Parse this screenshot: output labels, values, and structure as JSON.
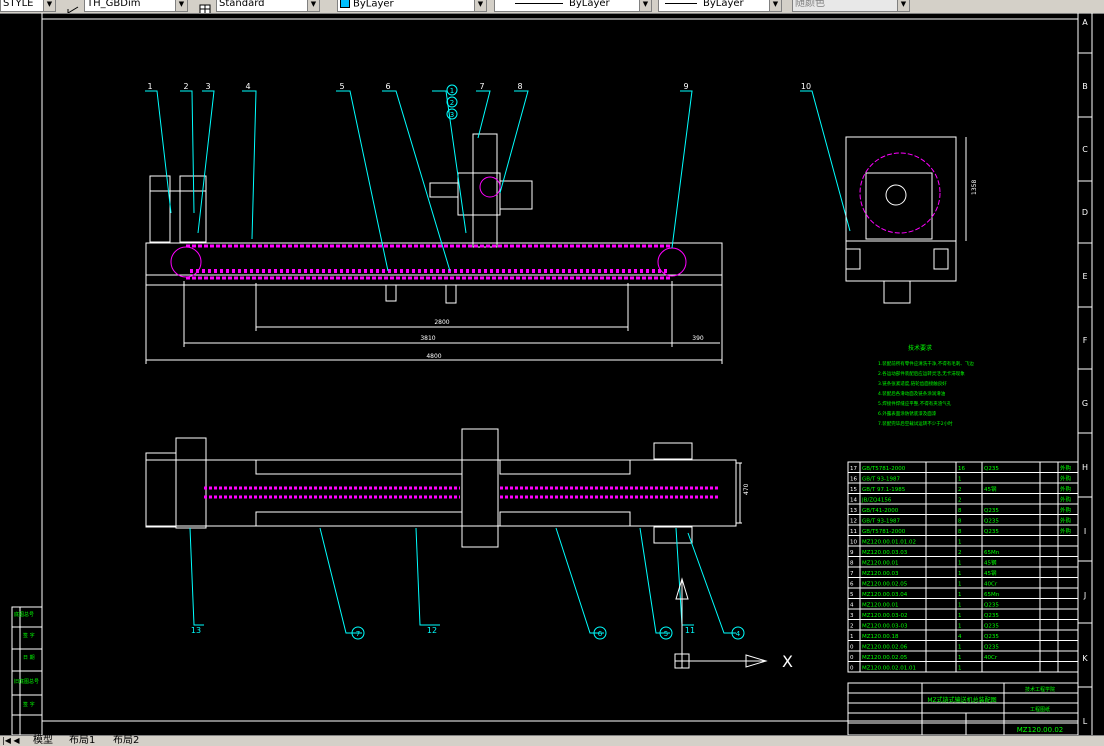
{
  "toolbar": {
    "textstyle_fragment": "STYLE",
    "dimstyle": "TH_GBDim",
    "tablestyle": "Standard",
    "layer": "ByLayer",
    "linetype": "ByLayer",
    "lineweight": "ByLayer",
    "plotcolor": "随颜色"
  },
  "tabs": {
    "model": "模型",
    "layout1": "布局1",
    "layout2": "布局2"
  },
  "drawing": {
    "border_rows": [
      "A",
      "B",
      "C",
      "D",
      "E",
      "F",
      "G",
      "H",
      "I",
      "J",
      "K",
      "L"
    ],
    "elev_callouts": [
      "1",
      "2",
      "3",
      "4",
      "5",
      "6",
      "7",
      "8",
      "9",
      "10"
    ],
    "circled_top": [
      "1",
      "2",
      "3"
    ],
    "plan_callouts": [
      "13",
      "7",
      "12",
      "6",
      "5",
      "11",
      "4"
    ],
    "dims": {
      "d2800": "2800",
      "d3810": "3810",
      "d4800": "4800",
      "d390": "390",
      "d1358": "1358",
      "d470": "470"
    },
    "tech_title": "技术要求",
    "tech_lines": [
      "1.装配前所有零件应清洗干净,不得有毛刺、飞边",
      "2.各运动部件装配后应运转灵活,无卡滞现象",
      "3.链条张紧适度,链轮齿面接触良好",
      "4.装配后各滑动面及链条涂润滑油",
      "5.焊接件焊缝应平整,不得有夹渣气孔",
      "6.外露表面涂防锈底漆及面漆",
      "7.装配完毕后空载试运转不少于2小时"
    ],
    "axis_x": "X",
    "bom_rows": [
      [
        "17",
        "GB/T5781-2000",
        "",
        "16",
        "Q235",
        "",
        "外购"
      ],
      [
        "16",
        "GB/T 93-1987",
        "",
        "1",
        "",
        "",
        "外购"
      ],
      [
        "15",
        "GB/T 97.1-1985",
        "",
        "2",
        "45钢",
        "",
        "外购"
      ],
      [
        "14",
        "JB/ZQ4156",
        "",
        "2",
        "",
        "",
        "外购"
      ],
      [
        "13",
        "GB/T41-2000",
        "",
        "8",
        "Q235",
        "",
        "外购"
      ],
      [
        "12",
        "GB/T 93-1987",
        "",
        "8",
        "Q235",
        "",
        "外购"
      ],
      [
        "11",
        "GB/T5781-2000",
        "",
        "8",
        "Q235",
        "",
        "外购"
      ],
      [
        "10",
        "MZ120.00.01.01.02",
        "",
        "1",
        "",
        "",
        ""
      ],
      [
        "9",
        "MZ120.00.03.03",
        "",
        "2",
        "65Mn",
        "",
        ""
      ],
      [
        "8",
        "MZ120.00.01",
        "",
        "1",
        "45钢",
        "",
        ""
      ],
      [
        "7",
        "MZ120.00.03",
        "",
        "1",
        "45钢",
        "",
        ""
      ],
      [
        "6",
        "MZ120.00.02.05",
        "",
        "1",
        "40Cr",
        "",
        ""
      ],
      [
        "5",
        "MZ120.00.03.04",
        "",
        "1",
        "65Mn",
        "",
        ""
      ],
      [
        "4",
        "MZ120.00.01",
        "",
        "1",
        "Q235",
        "",
        ""
      ],
      [
        "3",
        "MZ120.00.03-02",
        "",
        "1",
        "Q235",
        "",
        ""
      ],
      [
        "2",
        "MZ120.00.03-03",
        "",
        "1",
        "Q235",
        "",
        ""
      ],
      [
        "1",
        "MZ120.00.18",
        "",
        "4",
        "Q235",
        "",
        ""
      ],
      [
        "0",
        "MZ120.00.02.06",
        "",
        "1",
        "Q235",
        "",
        ""
      ],
      [
        "0",
        "MZ120.00.02.05",
        "",
        "1",
        "40Cr",
        "",
        ""
      ],
      [
        "0",
        "MZ120.00.02.01.01",
        "",
        "1",
        "",
        "",
        ""
      ]
    ],
    "title_name": "MZ式链式输送机总装配图",
    "title_company": "技术工程学院",
    "title_subtitle": "工程图纸",
    "drawing_no": "MZ120.00.02",
    "left_stamp": [
      "底图总号",
      "签 字",
      "日 期",
      "旧底图总号",
      "签 字"
    ]
  },
  "colors": {
    "toolbar_bg": "#d4d0c8",
    "canvas_bg": "#000000",
    "frame": "#ffffff",
    "leader": "#00ffff",
    "chain": "#ff00ff",
    "text_green": "#00ff00"
  }
}
